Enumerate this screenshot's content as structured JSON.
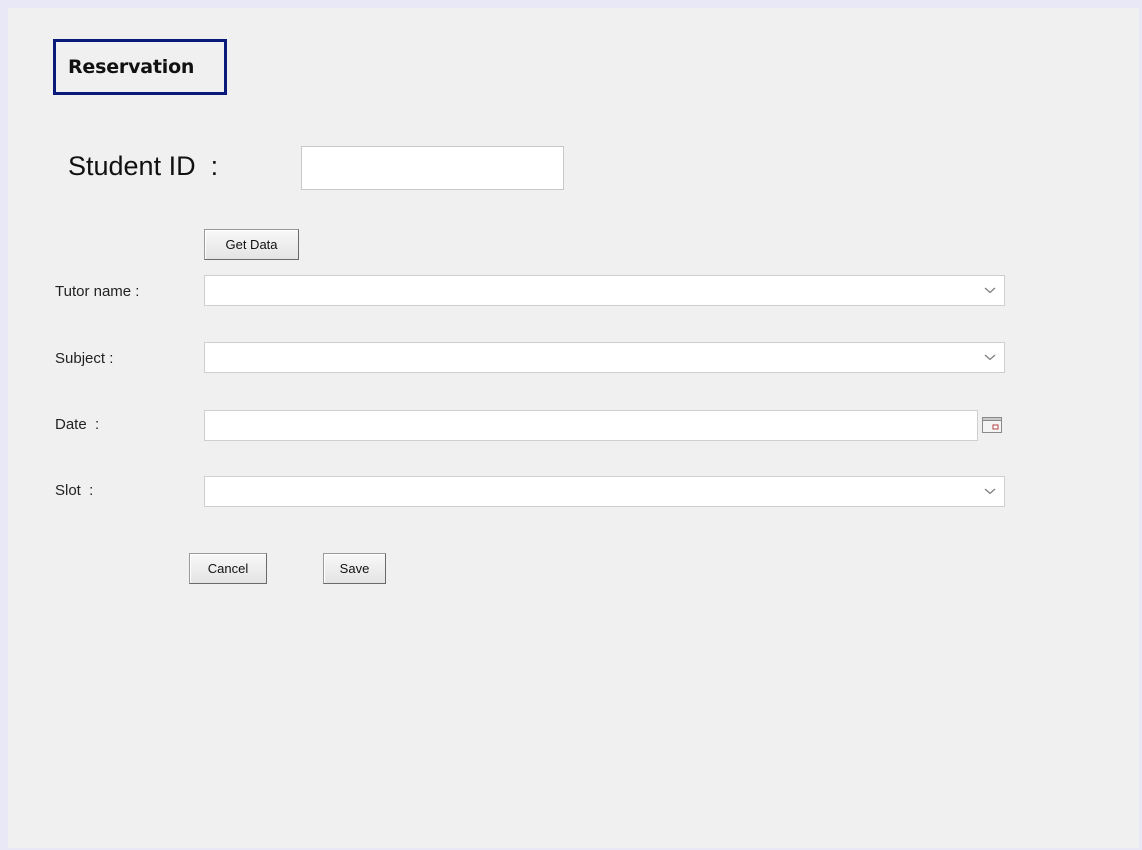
{
  "window": {
    "title": "Reservation"
  },
  "student": {
    "label": "Student ID  :",
    "value": "",
    "get_data_label": "Get Data"
  },
  "fields": {
    "tutor": {
      "label": "Tutor name :",
      "value": ""
    },
    "subject": {
      "label": "Subject :",
      "value": ""
    },
    "date": {
      "label": "Date  :",
      "value": ""
    },
    "slot": {
      "label": "Slot  :",
      "value": ""
    }
  },
  "actions": {
    "cancel_label": "Cancel",
    "save_label": "Save"
  },
  "icons": {
    "dropdown": "chevron-down-icon",
    "calendar": "calendar-icon"
  },
  "colors": {
    "title_border": "#0a1a7a",
    "panel_bg": "#f0f0f0"
  }
}
